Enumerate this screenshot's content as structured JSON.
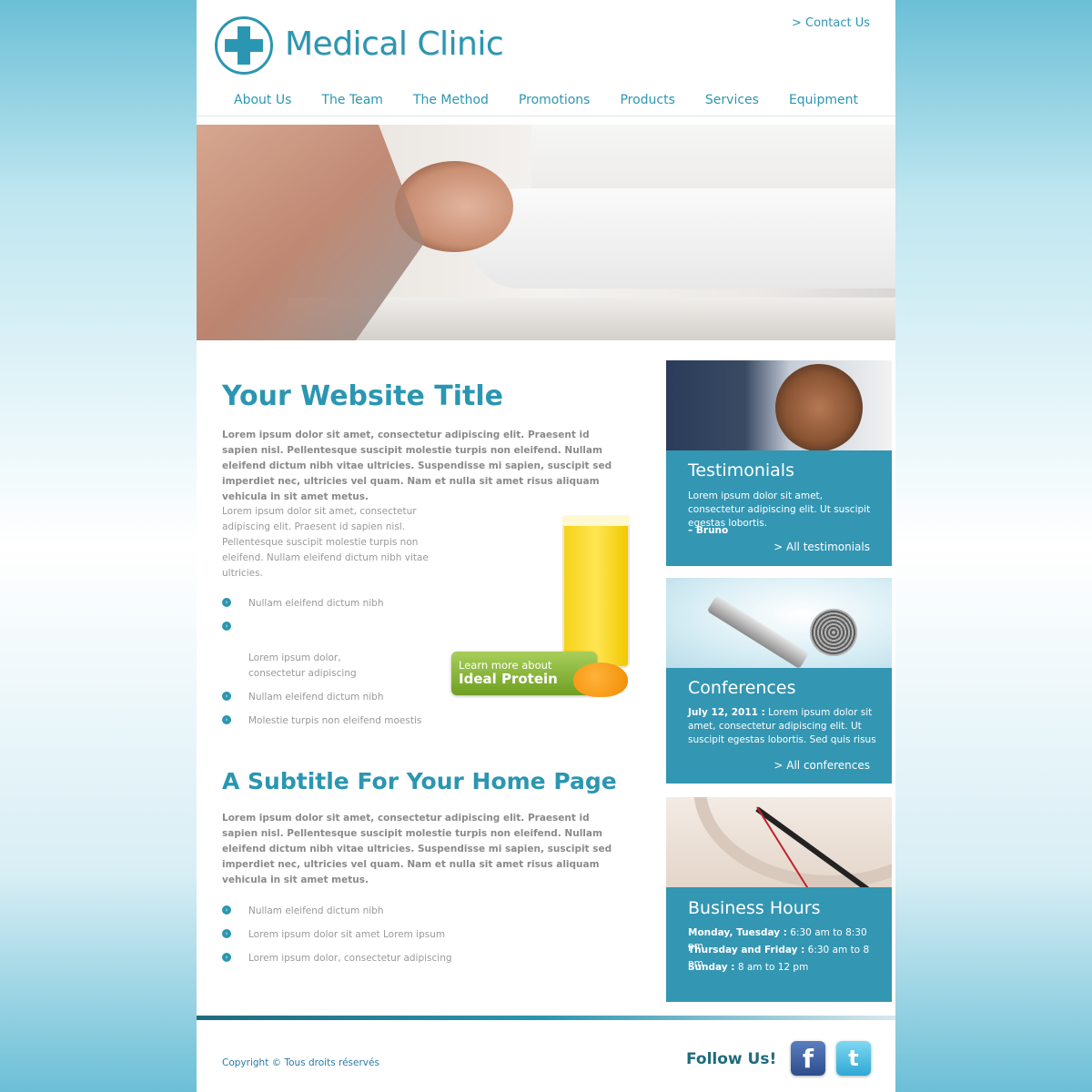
{
  "header": {
    "site_title": "Medical Clinic",
    "contact_link": ">  Contact Us"
  },
  "nav": {
    "items": [
      "About Us",
      "The Team",
      "The Method",
      "Promotions",
      "Products",
      "Services",
      "Equipment"
    ]
  },
  "main": {
    "title": "Your Website Title",
    "intro_bold": "Lorem ipsum dolor sit amet, consectetur adipiscing elit. Praesent id sapien nisl. Pellentesque suscipit molestie turpis non eleifend. Nullam eleifend dictum nibh vitae ultricies. Suspendisse mi sapien, suscipit sed imperdiet nec, ultricies vel quam. Nam et nulla sit amet risus aliquam vehicula in sit amet metus.",
    "intro_light": "Lorem ipsum dolor sit amet, consectetur adipiscing elit. Praesent id sapien nisl. Pellentesque suscipit molestie turpis non eleifend. Nullam eleifend dictum nibh vitae ultricies.",
    "bullets_1": [
      "Nullam eleifend dictum nibh",
      "Lorem ipsum dolor,\nconsectetur adipiscing",
      "Nullam eleifend dictum nibh",
      "Molestie turpis non eleifend moestis"
    ],
    "subtitle": "A Subtitle For Your Home Page",
    "body_bold": "Lorem ipsum dolor sit amet, consectetur adipiscing elit. Praesent id sapien nisl. Pellentesque suscipit molestie turpis non eleifend. Nullam eleifend dictum nibh vitae ultricies. Suspendisse mi sapien, suscipit sed imperdiet nec, ultricies vel quam. Nam et nulla sit amet risus aliquam vehicula in sit amet metus.",
    "bullets_2": [
      "Nullam eleifend dictum nibh",
      "Lorem ipsum dolor sit amet Lorem ipsum",
      "Lorem ipsum dolor, consectetur adipiscing"
    ]
  },
  "promo": {
    "line1": "Learn more about",
    "line2": "Ideal Protein"
  },
  "sidebar": {
    "testimonials": {
      "title": "Testimonials",
      "text": "Lorem ipsum dolor sit amet, consectetur adipiscing elit. Ut suscipit egestas lobortis.",
      "author": "–  Bruno",
      "link": ">  All testimonials"
    },
    "conferences": {
      "title": "Conferences",
      "date": "July 12, 2011 :",
      "text": " Lorem ipsum dolor sit amet, consectetur adipiscing elit. Ut suscipit egestas lobortis. Sed quis risus",
      "link": ">  All conferences"
    },
    "hours": {
      "title": "Business Hours",
      "rows": [
        {
          "day": "Monday, Tuesday :",
          "time": " 6:30 am to 8:30 pm"
        },
        {
          "day": "Thursday and Friday :",
          "time": " 6:30 am to 8 pm"
        },
        {
          "day": "Sunday :",
          "time": " 8 am to 12 pm"
        }
      ]
    }
  },
  "footer": {
    "copyright": "Copyright © Tous droits réservés",
    "follow": "Follow Us!",
    "facebook_glyph": "f",
    "twitter_glyph": "t"
  },
  "colors": {
    "accent": "#2b96b1",
    "box_bg": "#3396b3",
    "text_grey": "#999999"
  }
}
